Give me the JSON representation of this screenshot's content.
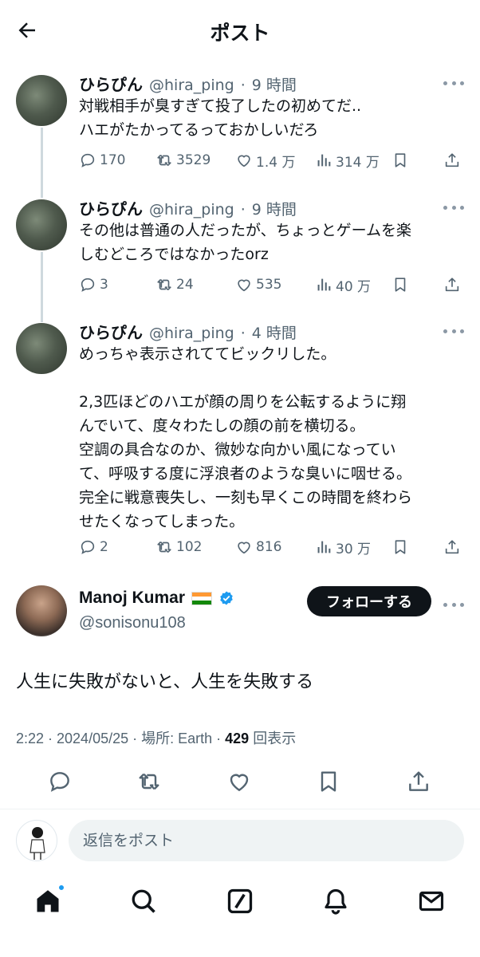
{
  "header": {
    "title": "ポスト"
  },
  "thread": [
    {
      "author": "ひらぴん",
      "handle": "@hira_ping",
      "sep": "·",
      "time": "9 時間",
      "text": "対戦相手が臭すぎて投了したの初めてだ..\nハエがたかってるっておかしいだろ",
      "replies": "170",
      "reposts": "3529",
      "likes": "1.4 万",
      "views": "314 万"
    },
    {
      "author": "ひらぴん",
      "handle": "@hira_ping",
      "sep": "·",
      "time": "9 時間",
      "text": "その他は普通の人だったが、ちょっとゲームを楽\nしむどころではなかったorz",
      "replies": "3",
      "reposts": "24",
      "likes": "535",
      "views": "40 万"
    },
    {
      "author": "ひらぴん",
      "handle": "@hira_ping",
      "sep": "·",
      "time": "4 時間",
      "text": "めっちゃ表示されててビックリした。\n\n2,3匹ほどのハエが顔の周りを公転するように翔\nんでいて、度々わたしの顔の前を横切る。\n空調の具合なのか、微妙な向かい風になってい\nて、呼吸する度に浮浪者のような臭いに咽せる。\n完全に戦意喪失し、一刻も早くこの時間を終わら\nせたくなってしまった。",
      "replies": "2",
      "reposts": "102",
      "likes": "816",
      "views": "30 万"
    }
  ],
  "main_post": {
    "author": "Manoj Kumar",
    "handle": "@sonisonu108",
    "follow_label": "フォローする",
    "text": "人生に失敗がないと、人生を失敗する",
    "meta_time": "2:22 · 2024/05/25 · 場所: Earth · ",
    "meta_views": "429",
    "meta_views_label": " 回表示"
  },
  "reply": {
    "placeholder": "返信をポスト"
  },
  "icons": {
    "back": "arrow-left-icon",
    "reply": "reply-icon",
    "repost": "repost-icon",
    "like": "heart-icon",
    "views": "analytics-icon",
    "bookmark": "bookmark-icon",
    "share": "share-icon",
    "home": "home-icon",
    "search": "search-icon",
    "compose": "compose-icon",
    "notifications": "bell-icon",
    "messages": "mail-icon"
  },
  "colors": {
    "accent": "#1d9bf0",
    "text": "#0f1419",
    "muted": "#536471",
    "follow_bg": "#0f1419"
  }
}
